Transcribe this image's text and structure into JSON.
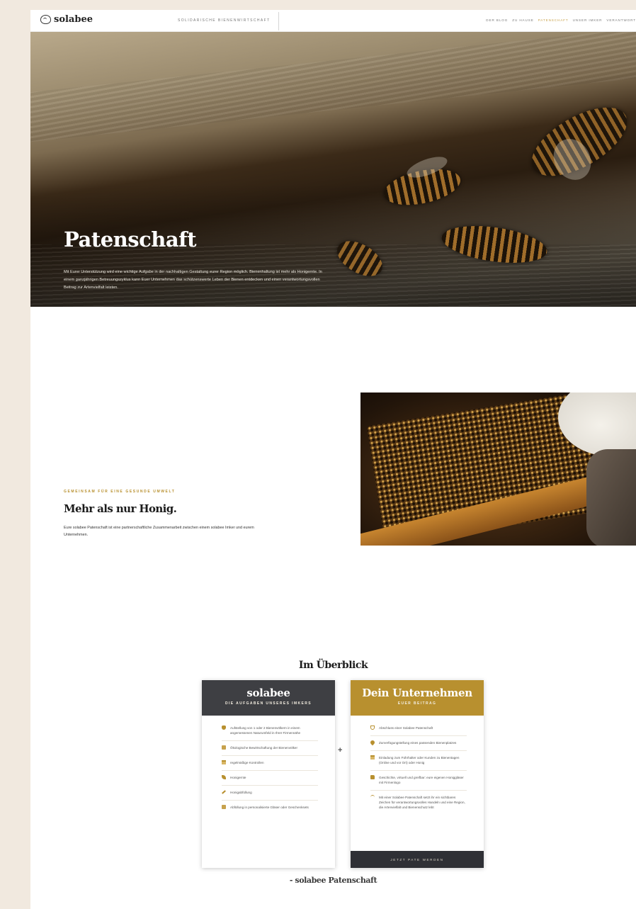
{
  "header": {
    "brand": "solabee",
    "tagline": "SOLIDARISCHE BIENENWIRTSCHAFT",
    "nav": [
      {
        "label": "DER BLOG",
        "active": false
      },
      {
        "label": "ZU HAUSE",
        "active": false
      },
      {
        "label": "PATENSCHAFT",
        "active": true
      },
      {
        "label": "UNSER IMKER",
        "active": false
      },
      {
        "label": "VERANTWORT",
        "active": false
      }
    ]
  },
  "hero": {
    "title": "Patenschaft",
    "text": "Mit Eurer Unterstützung wird eine wichtige Aufgabe in der nachhaltigen Gestaltung eurer Region möglich. Bienenhaltung ist mehr als Honigernte. In einem ganzjährigen Betreuungszyklus kann Euer Unternehmen das schützenswerte Leben der Bienen entdecken und einen verantwortungsvollen Beitrag zur Artenvielfalt leisten."
  },
  "intro": {
    "eyebrow": "GEMEINSAM FÜR EINE GESUNDE UMWELT",
    "title": "Mehr als nur Honig.",
    "text": "Eure solabee Patenschaft ist eine partnerschaftliche Zusammenarbeit zwischen einem solabee Imker und eurem Unternehmen."
  },
  "overview": {
    "title": "Im Überblick",
    "left_card": {
      "title": "solabee",
      "subtitle": "DIE AUFGABEN UNSERES IMKERS",
      "items": [
        {
          "icon": "shield-icon",
          "text": "Aufstellung von 1 oder 2 Bienenvölkern in einem angemessenen Naturumfeld in Ihrer Firmennähe"
        },
        {
          "icon": "box-icon",
          "text": "Ökologische Bewirtschaftung der Bienenvölker"
        },
        {
          "icon": "calendar-icon",
          "text": "regelmäßige Kontrollen"
        },
        {
          "icon": "leaf-icon",
          "text": "Honigernte"
        },
        {
          "icon": "tool-icon",
          "text": "Honigabfüllung"
        },
        {
          "icon": "jar-icon",
          "text": "Abfüllung in personalisierte Gläser oder Geschenksets"
        }
      ]
    },
    "plus": "+",
    "right_card": {
      "title": "Dein Unternehmen",
      "subtitle": "EUER BEITRAG",
      "items": [
        {
          "icon": "shield-outline-icon",
          "text": "Abschluss einer Solabee Patenschaft"
        },
        {
          "icon": "pin-icon",
          "text": "Zurverfügungstellung eines passenden Bienenplatzes"
        },
        {
          "icon": "calendar-icon",
          "text": "Einladung zum Führhalter oder Kunden zu Bienentagen (Online und vor Ort) oder Honig"
        },
        {
          "icon": "folder-icon",
          "text": "Geschichte, virtuell und greifbar: eure eigenen Honiggläser mit Firmenlogo"
        },
        {
          "icon": "bird-icon",
          "text": "Mit einer Solabee Patenschaft setzt ihr ein sichtbares Zeichen für verantwortungsvolles Handeln und eine Region, die Artenvielfalt und Bienenschutz lebt"
        }
      ],
      "cta": "JETZT PATE WERDEN"
    },
    "footnote": "- solabee Patenschaft"
  }
}
